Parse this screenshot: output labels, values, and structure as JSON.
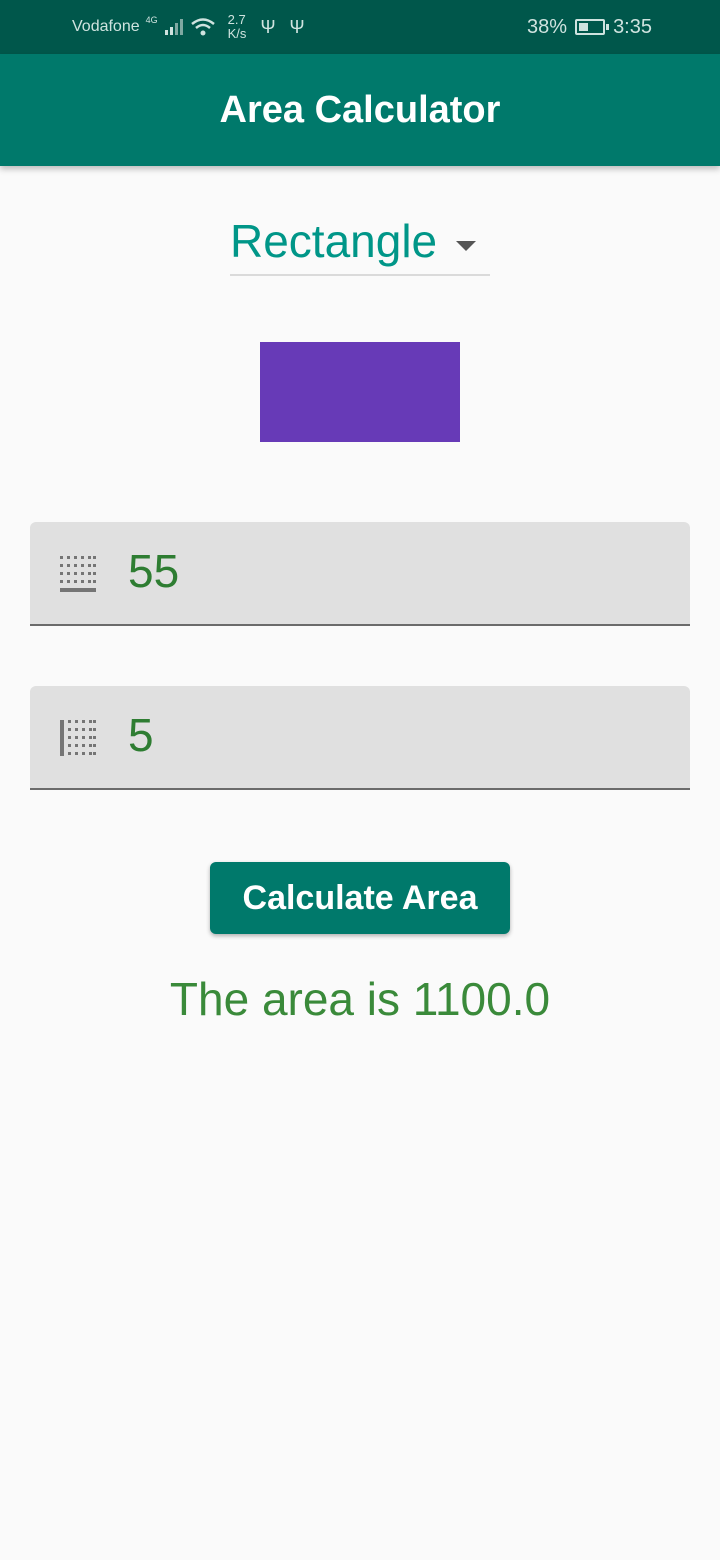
{
  "status_bar": {
    "carrier": "Vodafone",
    "network": "4G",
    "speed_value": "2.7",
    "speed_unit": "K/s",
    "battery": "38%",
    "time": "3:35"
  },
  "app_bar": {
    "title": "Area Calculator"
  },
  "shape_select": {
    "value": "Rectangle"
  },
  "shape_preview": {
    "color": "#673ab7"
  },
  "width_field": {
    "value": "55",
    "icon": "border-bottom-icon"
  },
  "height_field": {
    "value": "5",
    "icon": "border-left-icon"
  },
  "calculate_button": {
    "label": "Calculate Area"
  },
  "result": {
    "text": "The area is 1100.0"
  },
  "colors": {
    "primary": "#00796b",
    "accent": "#009688",
    "result": "#3a8a3a"
  }
}
